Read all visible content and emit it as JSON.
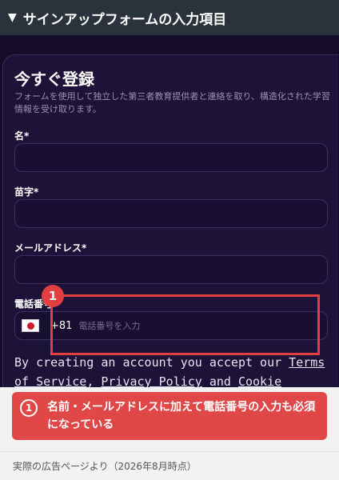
{
  "header": {
    "toggle": "▼",
    "title": "サインアップフォームの入力項目"
  },
  "form": {
    "title": "今すぐ登録",
    "description": "フォームを使用して独立した第三者教育提供者と連絡を取り、構造化された学習情報を受け取ります。",
    "fields": [
      {
        "label": "名*"
      },
      {
        "label": "苗字*"
      },
      {
        "label": "メールアドレス*"
      }
    ],
    "phone": {
      "label": "電話番号*",
      "country_code": "+81",
      "placeholder": "電話番号を入力",
      "flag": "japan-flag-icon"
    },
    "terms": {
      "prefix": "By creating an account you accept our ",
      "link1": "Terms",
      "line2_prefix": "of Service",
      "sep": ", ",
      "link2": "Privacy Policy",
      "and": " and ",
      "link3": "Cookie"
    }
  },
  "annotation": {
    "badge_number": "1",
    "note_number": "1",
    "note_text": "名前・メールアドレスに加えて電話番号の入力も必須になっている",
    "color": "#e04848"
  },
  "footer": {
    "caption": "実際の広告ページより（2026年8月時点）"
  }
}
